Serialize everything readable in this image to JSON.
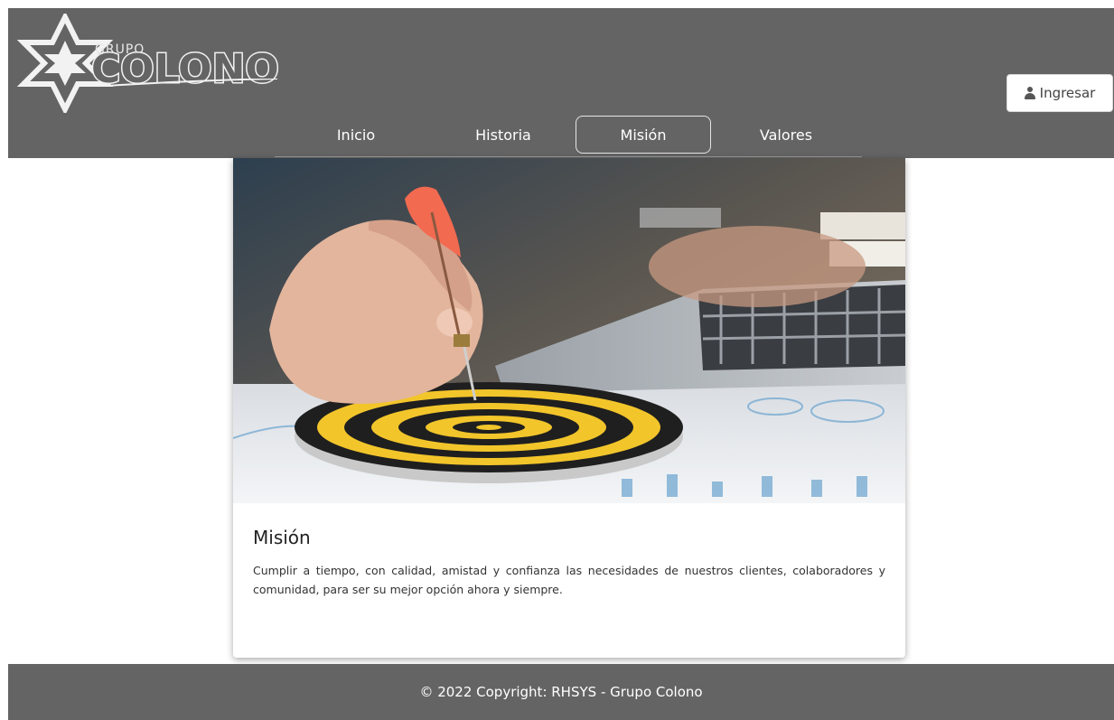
{
  "brand": {
    "small": "GRUPO",
    "large": "COLONO",
    "colors": {
      "header": "#646464",
      "logo": "#f2f2f2"
    }
  },
  "header": {
    "login_label": "Ingresar",
    "login_icon": "user-icon"
  },
  "nav": {
    "items": [
      {
        "label": "Inicio",
        "active": false
      },
      {
        "label": "Historia",
        "active": false
      },
      {
        "label": "Misión",
        "active": true
      },
      {
        "label": "Valores",
        "active": false
      }
    ]
  },
  "card": {
    "image": "dart-hitting-bullseye-photo",
    "title": "Misión",
    "text": "Cumplir a tiempo, con calidad, amistad y confianza las necesidades de nuestros clientes, colaboradores y comunidad, para ser su mejor opción ahora y siempre."
  },
  "footer": {
    "copyright": "© 2022 Copyright: RHSYS - Grupo Colono"
  }
}
